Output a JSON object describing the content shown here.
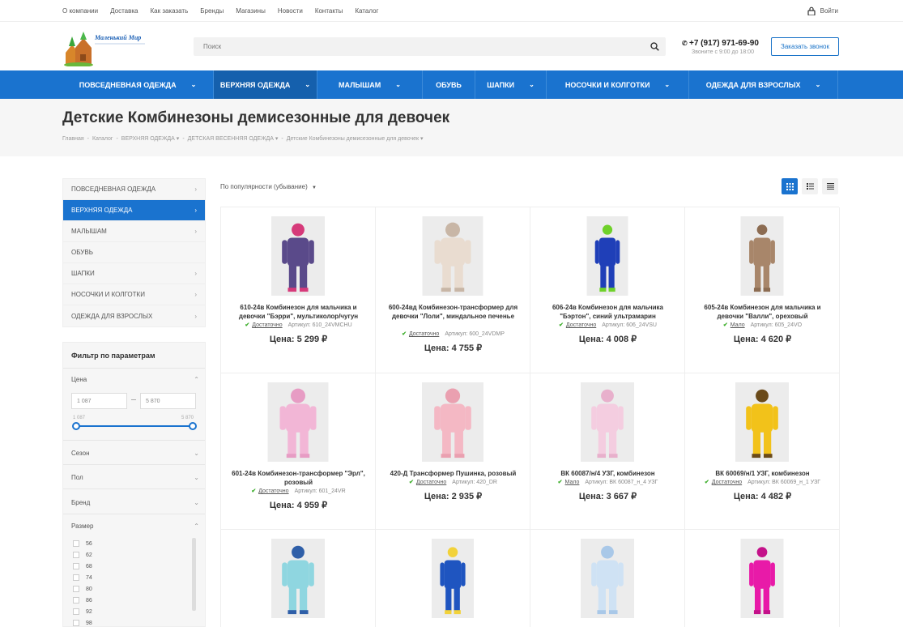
{
  "topnav": [
    "О компании",
    "Доставка",
    "Как заказать",
    "Бренды",
    "Магазины",
    "Новости",
    "Контакты",
    "Каталог"
  ],
  "login_label": "Войти",
  "logo_text": "Маленький Мир",
  "search_placeholder": "Поиск",
  "phone": "+7 (917) 971-69-90",
  "hours": "Звоните с 9:00 до 18:00",
  "callback_label": "Заказать звонок",
  "mainnav": [
    {
      "label": "ПОВСЕДНЕВНАЯ ОДЕЖДА",
      "chevron": true
    },
    {
      "label": "ВЕРХНЯЯ ОДЕЖДА",
      "chevron": true,
      "active": true
    },
    {
      "label": "МАЛЫШАМ",
      "chevron": true
    },
    {
      "label": "ОБУВЬ",
      "chevron": false
    },
    {
      "label": "ШАПКИ",
      "chevron": true
    },
    {
      "label": "НОСОЧКИ И КОЛГОТКИ",
      "chevron": true
    },
    {
      "label": "ОДЕЖДА ДЛЯ ВЗРОСЛЫХ",
      "chevron": true
    }
  ],
  "page_title": "Детские Комбинезоны демисезонные для девочек",
  "breadcrumbs": [
    "Главная",
    "-",
    "Каталог",
    "-",
    "ВЕРХНЯЯ ОДЕЖДА ▾",
    "-",
    "ДЕТСКАЯ ВЕСЕННЯЯ ОДЕЖДА ▾",
    "-",
    "Детские Комбинезоны демисезонные для девочек ▾"
  ],
  "sidebar": [
    {
      "label": "ПОВСЕДНЕВНАЯ ОДЕЖДА",
      "arrow": true
    },
    {
      "label": "ВЕРХНЯЯ ОДЕЖДА",
      "arrow": true,
      "active": true
    },
    {
      "label": "МАЛЫШАМ",
      "arrow": true
    },
    {
      "label": "ОБУВЬ",
      "arrow": false
    },
    {
      "label": "ШАПКИ",
      "arrow": true
    },
    {
      "label": "НОСОЧКИ И КОЛГОТКИ",
      "arrow": true
    },
    {
      "label": "ОДЕЖДА ДЛЯ ВЗРОСЛЫХ",
      "arrow": true
    }
  ],
  "filter": {
    "title": "Фильтр по параметрам",
    "price_label": "Цена",
    "price_min": "1 087",
    "price_max": "5 870",
    "range_min": "1 087",
    "range_max": "5 870",
    "season": "Сезон",
    "gender": "Пол",
    "brand": "Бренд",
    "size": "Размер",
    "sizes": [
      "56",
      "62",
      "68",
      "74",
      "80",
      "86",
      "92",
      "98"
    ]
  },
  "sort_label": "По популярности (убывание)",
  "products": [
    {
      "name": "610-24в Комбинезон для мальчика и девочки \"Бэрри\", мультиколор/чугун",
      "stock": "Достаточно",
      "sku": "Артикул: 610_24VMCHU",
      "price": "Цена: 5 299 ₽",
      "color": "#5a4a8a",
      "accent": "#d63a7a"
    },
    {
      "name": "600-24вд Комбинезон-трансформер для девочки \"Лоли\", миндальное печенье",
      "stock": "Достаточно",
      "sku": "Артикул: 600_24VDMP",
      "price": "Цена: 4 755 ₽",
      "color": "#e9dcd0",
      "accent": "#c8b6a6"
    },
    {
      "name": "606-24в Комбинезон для мальчика \"Бэртон\", синий ультрамарин",
      "stock": "Достаточно",
      "sku": "Артикул: 606_24VSU",
      "price": "Цена: 4 008 ₽",
      "color": "#1f3fb8",
      "accent": "#6fd12a"
    },
    {
      "name": "605-24в Комбинезон для мальчика и девочки \"Валли\", ореховый",
      "stock": "Мало",
      "sku": "Артикул: 605_24VO",
      "price": "Цена: 4 620 ₽",
      "color": "#a8866a",
      "accent": "#8c6c52"
    },
    {
      "name": "601-24в Комбинезон-трансформер \"Эрл\", розовый",
      "stock": "Достаточно",
      "sku": "Артикул: 601_24VR",
      "price": "Цена: 4 959 ₽",
      "color": "#f2b6d6",
      "accent": "#e79cc4"
    },
    {
      "name": "420-Д Трансформер Пушинка, розовый",
      "stock": "Достаточно",
      "sku": "Артикул: 420_DR",
      "price": "Цена: 2 935 ₽",
      "color": "#f4b8c4",
      "accent": "#eaa0b0"
    },
    {
      "name": "ВК 60087/н/4 УЗГ, комбинезон",
      "stock": "Мало",
      "sku": "Артикул: ВК 60087_н_4 УЗГ",
      "price": "Цена: 3 667 ₽",
      "color": "#f4cde0",
      "accent": "#e8b0cc"
    },
    {
      "name": "ВК 60069/н/1 УЗГ, комбинезон",
      "stock": "Достаточно",
      "sku": "Артикул: ВК 60069_н_1 УЗГ",
      "price": "Цена: 4 482 ₽",
      "color": "#f2c21a",
      "accent": "#6a4a1a"
    },
    {
      "name": "",
      "stock": "",
      "sku": "",
      "price": "",
      "color": "#8fd6e0",
      "accent": "#2f5fa8"
    },
    {
      "name": "",
      "stock": "",
      "sku": "",
      "price": "",
      "color": "#1f55c0",
      "accent": "#f2d23a"
    },
    {
      "name": "",
      "stock": "",
      "sku": "",
      "price": "",
      "color": "#cfe2f4",
      "accent": "#a9c8e8"
    },
    {
      "name": "",
      "stock": "",
      "sku": "",
      "price": "",
      "color": "#e81aa8",
      "accent": "#c4128a"
    }
  ]
}
